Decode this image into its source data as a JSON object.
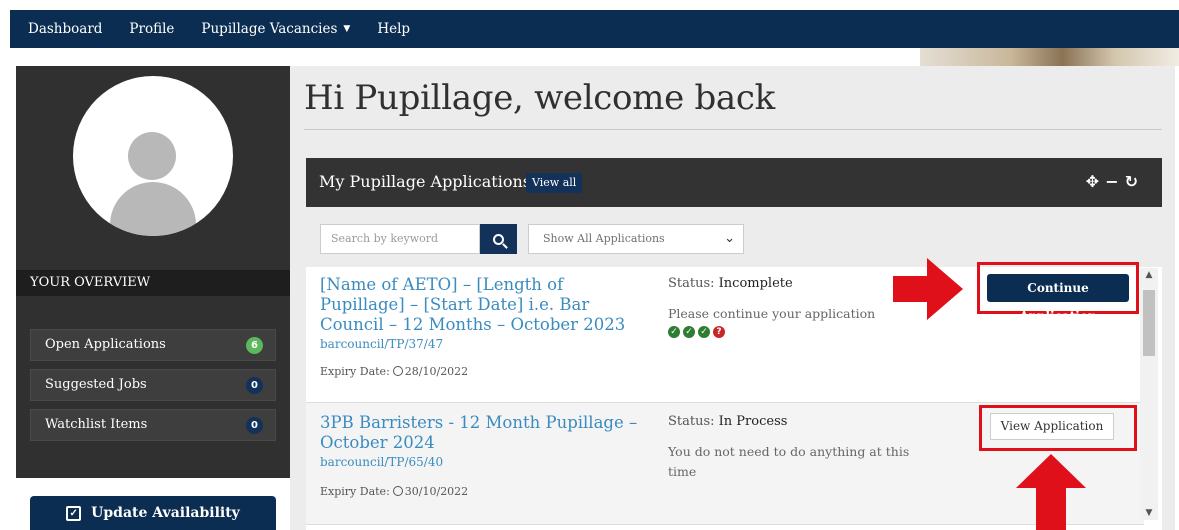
{
  "nav": {
    "items": [
      {
        "label": "Dashboard"
      },
      {
        "label": "Profile"
      },
      {
        "label": "Pupillage Vacancies",
        "has_caret": true
      },
      {
        "label": "Help"
      }
    ]
  },
  "sidebar": {
    "overview_label": "YOUR OVERVIEW",
    "items": [
      {
        "label": "Open Applications",
        "count": "6",
        "badge_color": "#5cb85c"
      },
      {
        "label": "Suggested Jobs",
        "count": "0",
        "badge_color": "#12325a"
      },
      {
        "label": "Watchlist Items",
        "count": "0",
        "badge_color": "#12325a"
      }
    ],
    "update_button": "Update Availability"
  },
  "main": {
    "welcome": "Hi Pupillage, welcome back",
    "card": {
      "title": "My Pupillage Applications",
      "view_all": "View all",
      "search_placeholder": "Search by keyword",
      "filter_selected": "Show All Applications",
      "applications": [
        {
          "title": "[Name of AETO] – [Length of Pupillage] – [Start Date] i.e. Bar Council – 12 Months – October 2023",
          "ref": "barcouncil/TP/37/47",
          "expiry_label": "Expiry Date:",
          "expiry_date": "28/10/2022",
          "status_label": "Status:",
          "status": "Incomplete",
          "message": "Please continue your application",
          "progress": [
            "complete",
            "complete",
            "complete",
            "incomplete"
          ],
          "action": "Continue Application"
        },
        {
          "title": "3PB Barristers - 12 Month Pupillage – October 2024",
          "ref": "barcouncil/TP/65/40",
          "expiry_label": "Expiry Date:",
          "expiry_date": "30/10/2022",
          "status_label": "Status:",
          "status": "In Process",
          "message": "You do not need to do anything at this time",
          "action": "View Application"
        }
      ]
    }
  },
  "colors": {
    "navy": "#0c2d52",
    "link_blue": "#3a8bbf",
    "highlight_red": "#e0101a",
    "sidebar_dark": "#303030"
  }
}
